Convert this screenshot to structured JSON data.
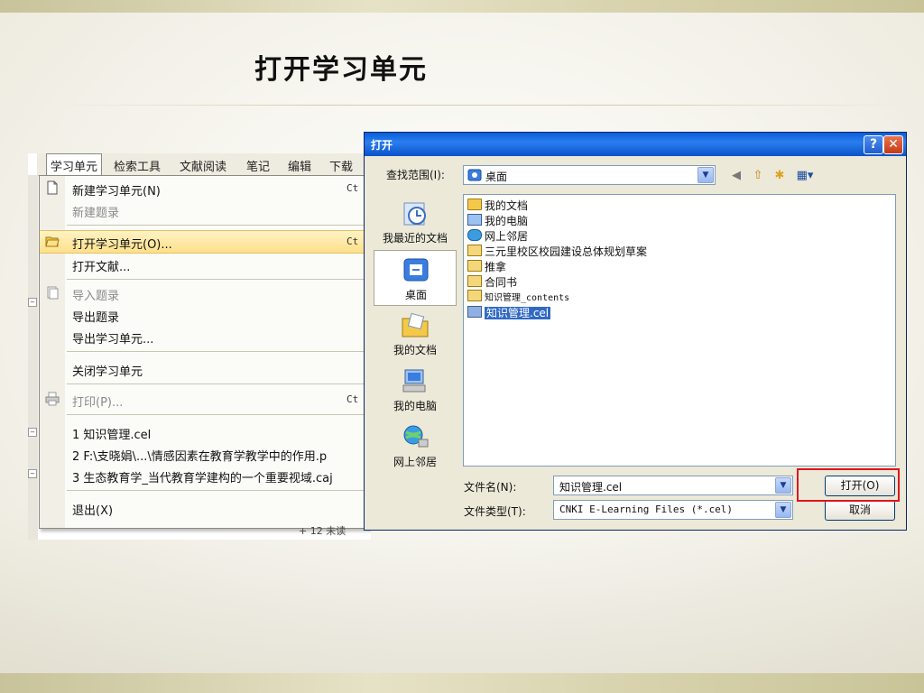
{
  "slide": {
    "title": "打开学习单元"
  },
  "menu": {
    "menubar": [
      "学习单元",
      "检索工具",
      "文献阅读",
      "笔记",
      "编辑",
      "下载"
    ],
    "items": [
      {
        "label": "新建学习单元(N)",
        "shortcut": "Ct"
      },
      {
        "label": "新建题录"
      },
      {
        "label": "打开学习单元(O)...",
        "shortcut": "Ct"
      },
      {
        "label": "打开文献..."
      },
      {
        "label": "导入题录"
      },
      {
        "label": "导出题录"
      },
      {
        "label": "导出学习单元..."
      },
      {
        "label": "关闭学习单元"
      },
      {
        "label": "打印(P)...",
        "shortcut": "Ct"
      },
      {
        "label": "1 知识管理.cel"
      },
      {
        "label": "2 F:\\支晓娟\\...\\情感因素在教育学教学中的作用.p"
      },
      {
        "label": "3 生态教育学_当代教育学建构的一个重要视域.caj"
      },
      {
        "label": "退出(X)"
      }
    ],
    "under_text": "+ 12   未读"
  },
  "dialog": {
    "title": "打开",
    "help": "?",
    "close": "✕",
    "look_in_label": "查找范围(I):",
    "look_in_value": "桌面",
    "places": [
      "我最近的文档",
      "桌面",
      "我的文档",
      "我的电脑",
      "网上邻居"
    ],
    "files": [
      "我的文档",
      "我的电脑",
      "网上邻居",
      "三元里校区校园建设总体规划草案",
      "推拿",
      "合同书",
      "知识管理_contents",
      "知识管理.cel"
    ],
    "filename_label": "文件名(N):",
    "filename_value": "知识管理.cel",
    "filetype_label": "文件类型(T):",
    "filetype_value": "CNKI E-Learning Files (*.cel)",
    "open_button": "打开(O)",
    "cancel_button": "取消"
  },
  "colors": {
    "highlight_box": "#e0141e",
    "title_bar": "#0a5fd8",
    "selection": "#316ac5"
  }
}
